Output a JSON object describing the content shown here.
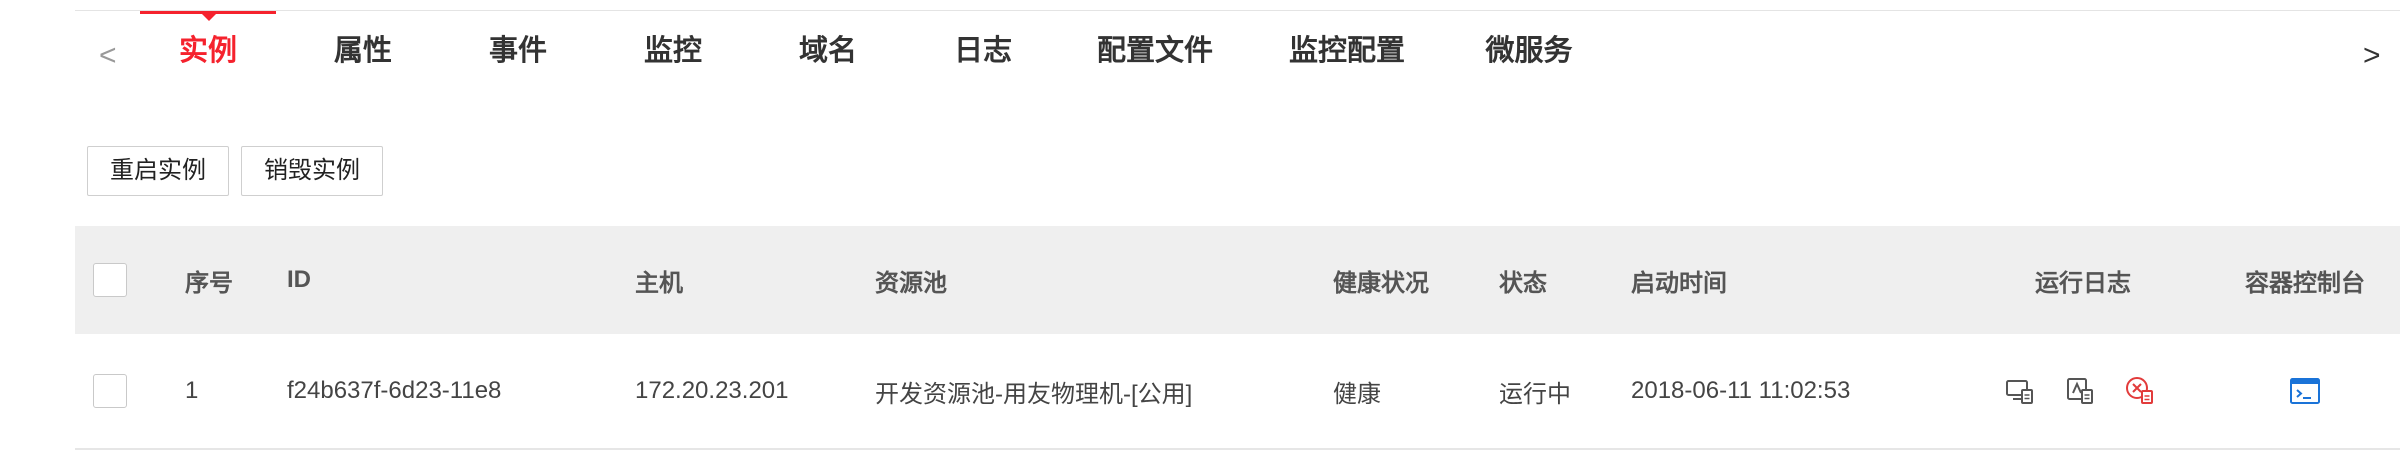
{
  "tabs": {
    "prev_arrow": "<",
    "next_arrow": ">",
    "items": [
      {
        "label": "实例",
        "active": true
      },
      {
        "label": "属性",
        "active": false
      },
      {
        "label": "事件",
        "active": false
      },
      {
        "label": "监控",
        "active": false
      },
      {
        "label": "域名",
        "active": false
      },
      {
        "label": "日志",
        "active": false
      },
      {
        "label": "配置文件",
        "active": false
      },
      {
        "label": "监控配置",
        "active": false
      },
      {
        "label": "微服务",
        "active": false
      }
    ]
  },
  "toolbar": {
    "restart_label": "重启实例",
    "destroy_label": "销毁实例"
  },
  "table": {
    "headers": {
      "index": "序号",
      "id": "ID",
      "host": "主机",
      "pool": "资源池",
      "health": "健康状况",
      "status": "状态",
      "start_time": "启动时间",
      "logs": "运行日志",
      "console": "容器控制台"
    },
    "rows": [
      {
        "index": "1",
        "id": "f24b637f-6d23-11e8",
        "host": "172.20.23.201",
        "pool": "开发资源池-用友物理机-[公用]",
        "health": "健康",
        "status": "运行中",
        "start_time": "2018-06-11 11:02:53"
      }
    ]
  },
  "colors": {
    "accent": "#f5222d",
    "link": "#1a73d8",
    "success": "#3aa63a"
  },
  "icons": [
    "log-view-icon",
    "log-download-icon",
    "log-delete-icon",
    "terminal-icon"
  ]
}
